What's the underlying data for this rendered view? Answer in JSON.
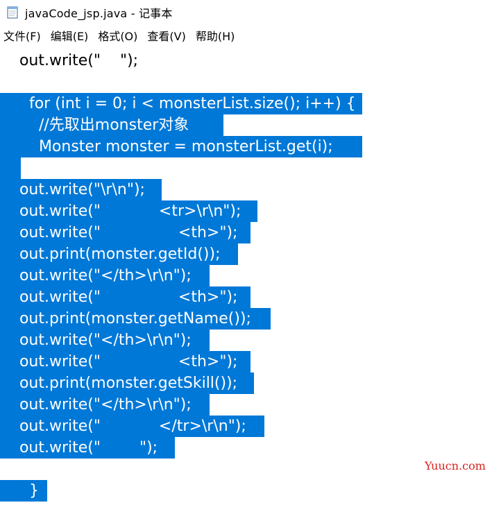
{
  "window": {
    "title": "javaCode_jsp.java - 记事本",
    "icon": "notepad-icon"
  },
  "menu": [
    {
      "label": "文件(F)"
    },
    {
      "label": "编辑(E)"
    },
    {
      "label": "格式(O)"
    },
    {
      "label": "查看(V)"
    },
    {
      "label": "帮助(H)"
    }
  ],
  "editor": {
    "selection_color": "#0078d7",
    "lines": [
      "    out.write(\"    \");",
      "",
      "      for (int i = 0; i < monsterList.size(); i++) {",
      "        //先取出monster对象",
      "        Monster monster = monsterList.get(i);",
      "",
      "    out.write(\"\\r\\n\");",
      "    out.write(\"            <tr>\\r\\n\");",
      "    out.write(\"                <th>\");",
      "    out.print(monster.getId());",
      "    out.write(\"</th>\\r\\n\");",
      "    out.write(\"                <th>\");",
      "    out.print(monster.getName());",
      "    out.write(\"</th>\\r\\n\");",
      "    out.write(\"                <th>\");",
      "    out.print(monster.getSkill());",
      "    out.write(\"</th>\\r\\n\");",
      "    out.write(\"            </tr>\\r\\n\");",
      "    out.write(\"        \");",
      "",
      "      }"
    ]
  },
  "watermark": "Yuucn.com"
}
